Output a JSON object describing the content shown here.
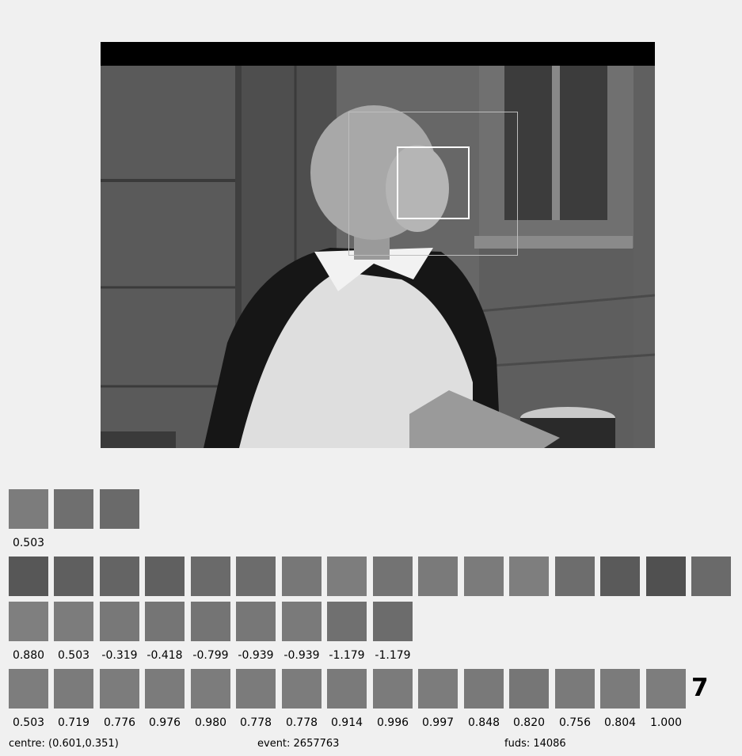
{
  "image": {
    "description": "scene"
  },
  "top_row": {
    "labels": [
      "0.503"
    ]
  },
  "middle_row": {
    "labels": [
      "0.880",
      "0.503",
      "-0.319",
      "-0.418",
      "-0.799",
      "-0.939",
      "-0.939",
      "-1.179",
      "-1.179"
    ]
  },
  "bottom_row": {
    "labels": [
      "0.503",
      "0.719",
      "0.776",
      "0.976",
      "0.980",
      "0.778",
      "0.778",
      "0.914",
      "0.996",
      "0.997",
      "0.848",
      "0.820",
      "0.756",
      "0.804",
      "1.000"
    ]
  },
  "big_number": "7",
  "footer": {
    "centre": "centre: (0.601,0.351)",
    "event": "event: 2657763",
    "fuds": "fuds: 14086"
  },
  "colors": {
    "background": "#f0f0f0",
    "tile": "#777777",
    "selection": "#ffffff"
  }
}
